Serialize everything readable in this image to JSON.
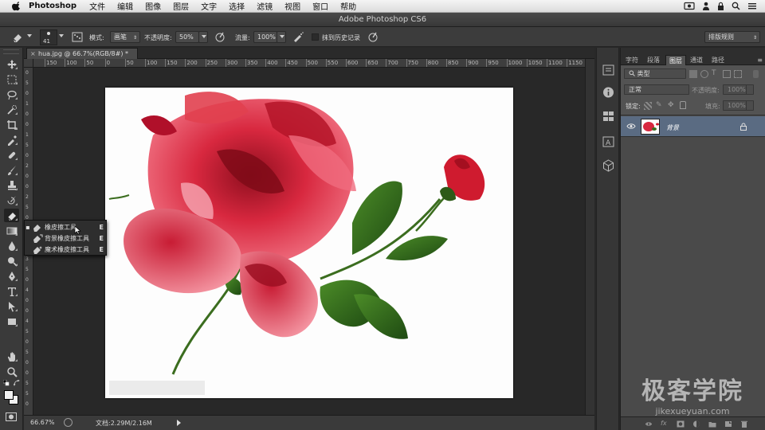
{
  "menubar": {
    "app_name": "Photoshop",
    "items": [
      "文件",
      "编辑",
      "图像",
      "图层",
      "文字",
      "选择",
      "滤镜",
      "视图",
      "窗口",
      "帮助"
    ],
    "tray_icons": [
      "screen-record-icon",
      "person-icon",
      "lock-icon",
      "search-icon",
      "list-icon"
    ]
  },
  "titlebar": {
    "title": "Adobe Photoshop CS6"
  },
  "options": {
    "brush_size": "41",
    "mode_label": "模式:",
    "mode_value": "画笔",
    "opacity_label": "不透明度:",
    "opacity_value": "50%",
    "flow_label": "流量:",
    "flow_value": "100%",
    "erase_history_label": "抹到历史记录",
    "workspace": "排版规则"
  },
  "document": {
    "tab_title": "hua.jpg @ 66.7%(RGB/8#) *",
    "close_glyph": "×",
    "ruler_h": [
      "150",
      "100",
      "50",
      "0",
      "50",
      "100",
      "150",
      "200",
      "250",
      "300",
      "350",
      "400",
      "450",
      "500",
      "550",
      "600",
      "650",
      "700",
      "750",
      "800",
      "850",
      "900",
      "950",
      "1000",
      "1050",
      "1100",
      "1150",
      "1200"
    ],
    "ruler_v": [
      "0",
      "5",
      "0",
      "1",
      "0",
      "0",
      "1",
      "5",
      "0",
      "2",
      "0",
      "0",
      "2",
      "5",
      "0",
      "3",
      "0",
      "0",
      "3",
      "5",
      "0",
      "4",
      "0",
      "0",
      "4",
      "5",
      "0",
      "5",
      "0",
      "0",
      "5",
      "5",
      "0"
    ]
  },
  "tools": [
    {
      "name": "move-tool-icon"
    },
    {
      "name": "marquee-tool-icon"
    },
    {
      "name": "lasso-tool-icon"
    },
    {
      "name": "quick-select-tool-icon"
    },
    {
      "name": "crop-tool-icon"
    },
    {
      "name": "eyedropper-tool-icon"
    },
    {
      "name": "healing-brush-tool-icon"
    },
    {
      "name": "brush-tool-icon"
    },
    {
      "name": "clone-stamp-tool-icon"
    },
    {
      "name": "history-brush-tool-icon"
    },
    {
      "name": "eraser-tool-icon"
    },
    {
      "name": "gradient-tool-icon"
    },
    {
      "name": "blur-tool-icon"
    },
    {
      "name": "dodge-tool-icon"
    },
    {
      "name": "pen-tool-icon"
    },
    {
      "name": "type-tool-icon"
    },
    {
      "name": "path-select-tool-icon"
    },
    {
      "name": "shape-tool-icon"
    },
    {
      "name": "hand-tool-icon"
    },
    {
      "name": "zoom-tool-icon"
    }
  ],
  "flyout": {
    "items": [
      {
        "label": "橡皮擦工具",
        "key": "E",
        "selected": true
      },
      {
        "label": "背景橡皮擦工具",
        "key": "E",
        "selected": false
      },
      {
        "label": "魔术橡皮擦工具",
        "key": "E",
        "selected": false
      }
    ],
    "selected_marker": "▪"
  },
  "status": {
    "zoom": "66.67%",
    "doc_info": "文档:2.29M/2.16M"
  },
  "panel": {
    "tabs": [
      "字符",
      "段落",
      "图层",
      "通道",
      "路径"
    ],
    "active_tab": "图层",
    "filter_kind": "类型",
    "blend_mode": "正常",
    "opacity_label": "不透明度:",
    "opacity_value": "100%",
    "lock_label": "锁定:",
    "fill_label": "填充:",
    "fill_value": "100%",
    "layer_name": "背景",
    "footer_fx": "fx"
  },
  "watermark": {
    "title": "极客学院",
    "url": "jikexueyuan.com"
  },
  "colors": {
    "accent_layer": "#5a6b82",
    "ui_dark": "#282828",
    "panel": "#535353"
  }
}
